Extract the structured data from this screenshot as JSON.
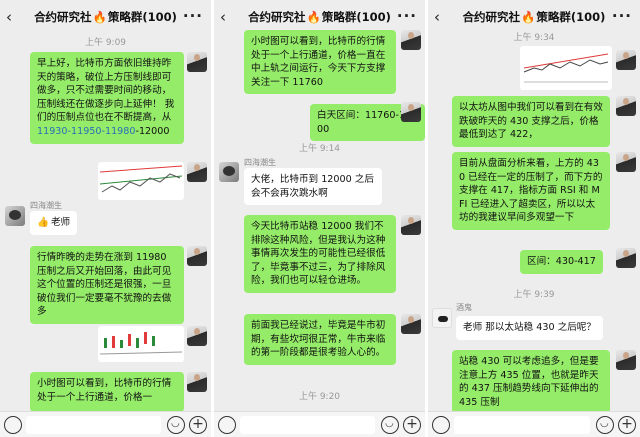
{
  "header": {
    "title_prefix": "合约研究社",
    "fire": "🔥",
    "title_suffix": "策略群(100)",
    "back_icon": "‹",
    "more_icon": "···"
  },
  "p1": {
    "time1": "上午 9:09",
    "msg1_a": "早上好，比特币方面依旧维持昨天的策略，破位上方压制线即可做多，只不过需要时间的移动，压制线还在做逐步向上延伸！ 我们的压制点位也在不断提高，从 ",
    "msg1_hl": "11930-11950-11980",
    "msg1_b": "-12000",
    "nick": "四海潮生",
    "msg2_emoji": "👍",
    "msg2": "老师",
    "msg3": "行情昨晚的走势在涨到 11980 压制之后又开始回落，由此可见这个位置的压制还是很强，一旦破位我们一定要毫不犹豫的去做多",
    "msg4": "小时图可以看到，比特币的行情处于一个上行通道，价格一"
  },
  "p2": {
    "msg1": "小时图可以看到，比特币的行情处于一个上行通道，价格一直在中上轨之间运行，今天下方支撑关注一下 11760",
    "msg2": "白天区间：11760-12000",
    "time1": "上午 9:14",
    "nick": "四海潮生",
    "msg3": "大佬，比特币到 12000 之后会不会再次跳水啊",
    "msg4": "今天比特币站稳 12000 我们不排除这种风险，但是我认为这种事情再次发生的可能性已经很低了，毕竟事不过三，为了排除风险，我们也可以轻仓进场。",
    "msg5": "前面我已经说过，毕竟是牛市初期，有些坎坷很正常，牛市来临的第一阶段都是很考验人心的。",
    "time2": "上午 9:20"
  },
  "p3": {
    "time1": "上午 9:34",
    "msg1": "以太坊从图中我们可以看到在有效跌破昨天的 430 支撑之后，价格最低到达了 422，",
    "msg2": "目前从盘面分析来看，上方的 430 已经在一定的压制了，而下方的支撑在 417，指标方面 RSI 和 MFI 已经进入了超卖区，所以以太坊的我建议早间多观望一下",
    "msg3": "区间：430-417",
    "time2": "上午 9:39",
    "nick": "酒鬼",
    "msg4": "老师 那以太站稳 430 之后呢？",
    "msg5": "站稳 430 可以考虑追多，但是要注意上方 435 位置，也就是昨天的 437 压制趋势线向下延伸出的 435 压制"
  }
}
